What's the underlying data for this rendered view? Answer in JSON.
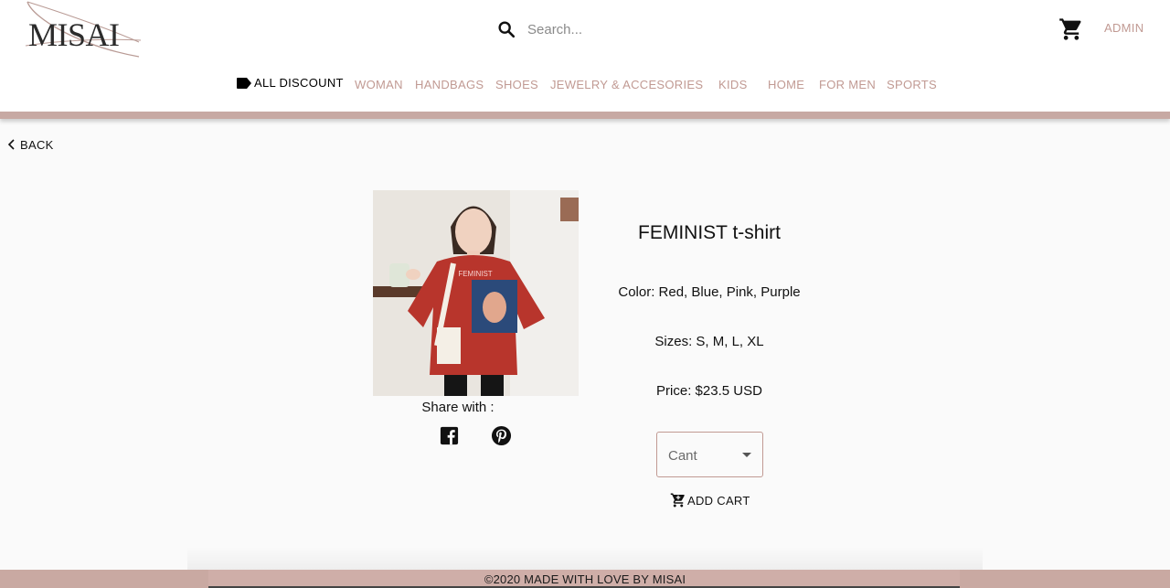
{
  "header": {
    "logo_text": "MISAI",
    "search": {
      "placeholder": "Search..."
    },
    "admin_label": "ADMIN"
  },
  "nav": {
    "discount_label": "ALL DISCOUNT",
    "items": [
      {
        "label": "WOMAN"
      },
      {
        "label": "HANDBAGS"
      },
      {
        "label": "SHOES"
      },
      {
        "label": "JEWELRY & ACCESORIES"
      },
      {
        "label": "KIDS"
      },
      {
        "label": "HOME"
      },
      {
        "label": "FOR MEN"
      },
      {
        "label": "SPORTS"
      }
    ]
  },
  "back_label": "BACK",
  "product": {
    "image_alt": "FEMINIST",
    "title": "FEMINIST t-shirt",
    "color": "Color: Red, Blue, Pink, Purple",
    "sizes": "Sizes: S, M, L, XL",
    "price": "Price: $23.5 USD",
    "quantity_placeholder": "Cant",
    "add_cart_label": "ADD CART"
  },
  "share": {
    "label": "Share with :"
  },
  "footer": {
    "text": "©2020 MADE WITH LOVE BY MISAI"
  },
  "colors": {
    "accent": "#c19a93",
    "bar": "#c7a9a3",
    "footer": "#c9a9a2"
  },
  "icons": [
    "search-icon",
    "cart-icon",
    "tag-icon",
    "chevron-left-icon",
    "facebook-icon",
    "pinterest-icon",
    "add-cart-icon",
    "chevron-down-icon"
  ]
}
